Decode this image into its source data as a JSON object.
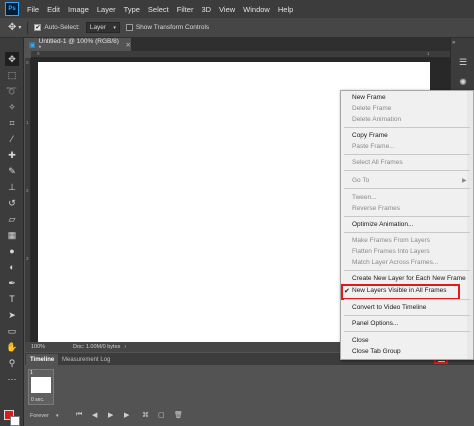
{
  "app": {
    "logo": "Ps",
    "menu": [
      "File",
      "Edit",
      "Image",
      "Layer",
      "Type",
      "Select",
      "Filter",
      "3D",
      "View",
      "Window",
      "Help"
    ]
  },
  "options_bar": {
    "auto_select_label": "Auto-Select:",
    "auto_select_value": "Layer",
    "transform_label": "Show Transform Controls"
  },
  "document": {
    "tab_title": "Untitled-1 @ 100% (RGB/8) *",
    "ruler_top_ticks": [
      "0",
      "1"
    ],
    "ruler_left_ticks": [
      "0",
      "1",
      "2",
      "3"
    ]
  },
  "status": {
    "zoom": "100%",
    "doc": "Doc: 1.00M/0 bytes"
  },
  "timeline": {
    "tab_timeline": "Timeline",
    "tab_measurement": "Measurement Log",
    "frame_number": "1",
    "frame_delay": "0 sec.",
    "loop": "Forever"
  },
  "flyout_menu": {
    "items": [
      {
        "label": "New Frame",
        "enabled": true
      },
      {
        "label": "Delete Frame",
        "enabled": false
      },
      {
        "label": "Delete Animation",
        "enabled": false
      },
      {
        "label": "Copy Frame",
        "enabled": true
      },
      {
        "label": "Paste Frame...",
        "enabled": false
      },
      {
        "label": "Select All Frames",
        "enabled": false
      },
      {
        "label": "Go To",
        "enabled": false
      },
      {
        "label": "Tween...",
        "enabled": false
      },
      {
        "label": "Reverse Frames",
        "enabled": false
      },
      {
        "label": "Optimize Animation...",
        "enabled": true
      },
      {
        "label": "Make Frames From Layers",
        "enabled": false
      },
      {
        "label": "Flatten Frames Into Layers",
        "enabled": false
      },
      {
        "label": "Match Layer Across Frames...",
        "enabled": false
      },
      {
        "label": "Create New Layer for Each New Frame",
        "enabled": true
      },
      {
        "label": "New Layers Visible in All Frames",
        "enabled": true,
        "checked": true
      },
      {
        "label": "Convert to Video Timeline",
        "enabled": true
      },
      {
        "label": "Panel Options...",
        "enabled": true
      },
      {
        "label": "Close",
        "enabled": true
      },
      {
        "label": "Close Tab Group",
        "enabled": true
      }
    ]
  },
  "colors": {
    "foreground": "#e01a1a",
    "background": "#ffffff",
    "highlight": "#e01a1a"
  }
}
